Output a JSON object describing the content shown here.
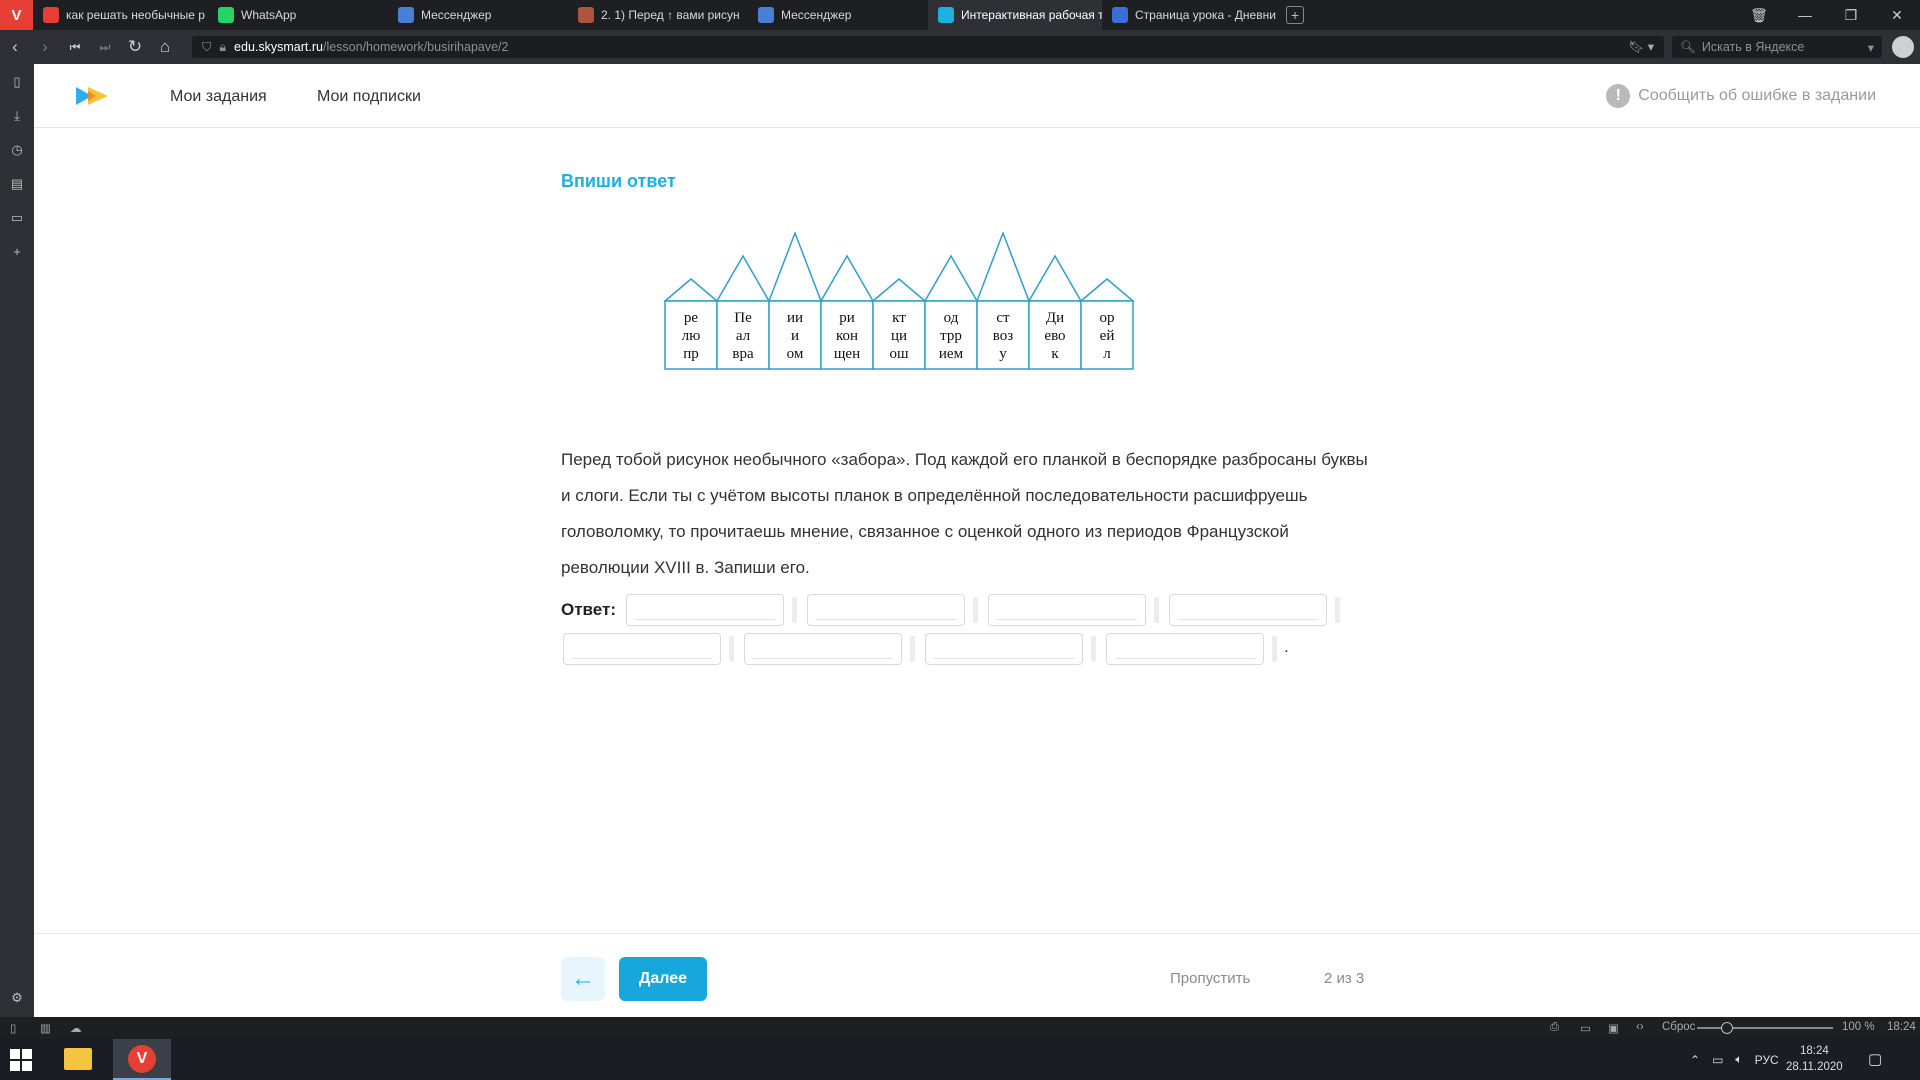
{
  "browser": {
    "tabs": [
      {
        "label": "как решать необычные р",
        "icon": "yandex-icon",
        "color": "#e63f35"
      },
      {
        "label": "WhatsApp",
        "icon": "whatsapp-icon",
        "color": "#25d366"
      },
      {
        "label": "Мессенджер",
        "icon": "messenger-icon",
        "color": "#4a7fd8"
      },
      {
        "label": "2. 1) Перед ↑ вами рисун",
        "icon": "page-icon",
        "color": "#b0553c"
      },
      {
        "label": "Мессенджер",
        "icon": "messenger-icon",
        "color": "#4a7fd8"
      },
      {
        "label": "Интерактивная рабочая т",
        "icon": "skysmart-icon",
        "color": "#1db0e0",
        "active": true
      },
      {
        "label": "Страница урока - Дневни",
        "icon": "diary-icon",
        "color": "#3a6fd8"
      }
    ],
    "url_domain": "edu.skysmart.ru",
    "url_path": "/lesson/homework/busirihapave/2",
    "search_placeholder": "Искать в Яндексе"
  },
  "site": {
    "nav": [
      "Мои задания",
      "Мои подписки"
    ],
    "report_label": "Сообщить об ошибке в задании"
  },
  "task": {
    "title": "Впиши ответ",
    "fence_planks": [
      {
        "lines": [
          "ре",
          "лю",
          "пр"
        ],
        "height_rank": 1
      },
      {
        "lines": [
          "Пе",
          "ал",
          "вра"
        ],
        "height_rank": 2
      },
      {
        "lines": [
          "ии",
          "и",
          "ом"
        ],
        "height_rank": 3
      },
      {
        "lines": [
          "ри",
          "кон",
          "щен"
        ],
        "height_rank": 2
      },
      {
        "lines": [
          "кт",
          "ци",
          "ош"
        ],
        "height_rank": 1
      },
      {
        "lines": [
          "од",
          "трр",
          "ием"
        ],
        "height_rank": 2
      },
      {
        "lines": [
          "ст",
          "воз",
          "у"
        ],
        "height_rank": 3
      },
      {
        "lines": [
          "Ди",
          "ево",
          "к"
        ],
        "height_rank": 2
      },
      {
        "lines": [
          "ор",
          "ей",
          "л"
        ],
        "height_rank": 1
      }
    ],
    "text": "Перед тобой рисунок необычного «забора». Под каждой его планкой в беспорядке разбросаны буквы и слоги. Если ты с учётом высоты планок в определённой последовательности расшифруешь головоломку, то прочитаешь мнение, связанное с оценкой одного из периодов Французской революции XVIII в. Запиши его.",
    "answer_label": "Ответ:",
    "answer_inputs": [
      "",
      "",
      "",
      "",
      "",
      "",
      "",
      ""
    ],
    "answer_end": "."
  },
  "footer": {
    "back_icon": "arrow-left-icon",
    "next_label": "Далее",
    "skip_label": "Пропустить",
    "progress": "2 из 3"
  },
  "statusbar": {
    "reset_label": "Сброс",
    "zoom": "100 %",
    "time": "18:24"
  },
  "taskbar": {
    "lang": "РУС",
    "time": "18:24",
    "date": "28.11.2020"
  }
}
